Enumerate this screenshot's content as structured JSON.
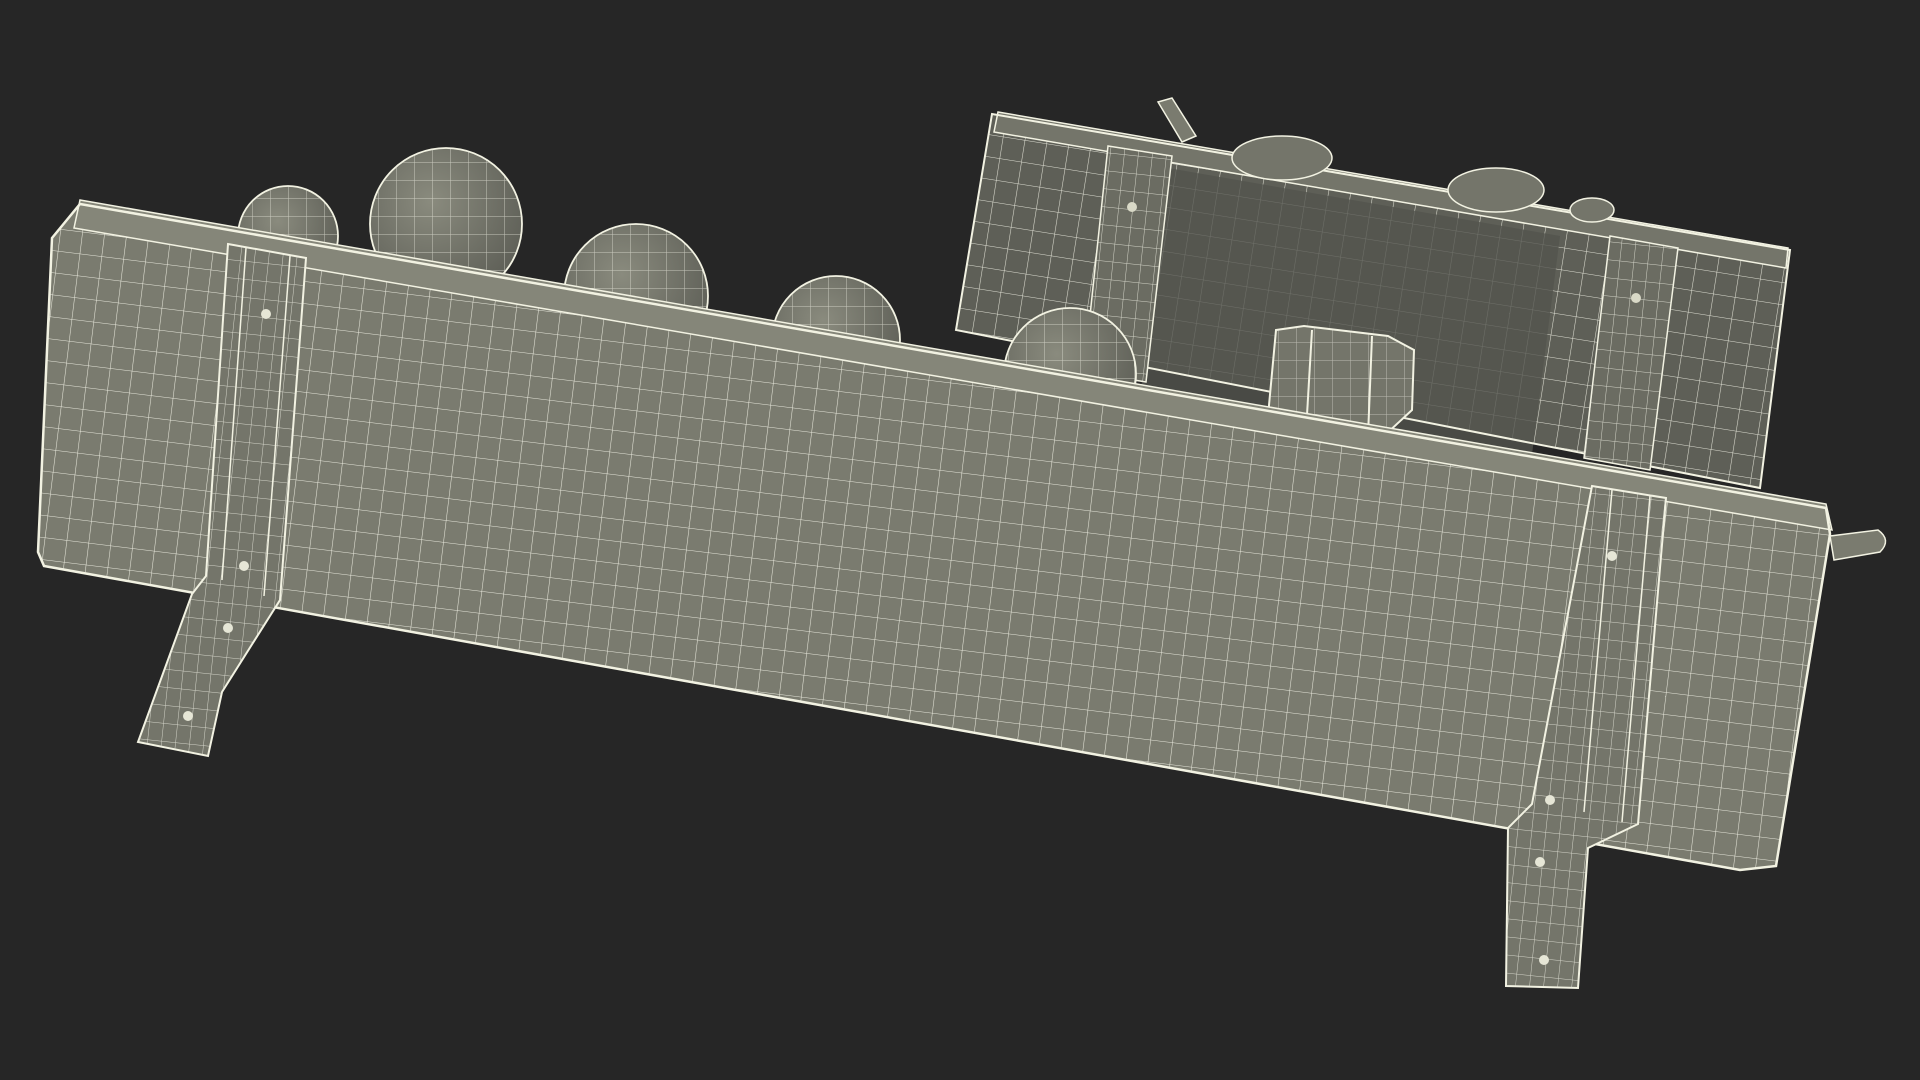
{
  "scene": {
    "subject": "wireframe-3d-model",
    "colors": {
      "background": "#262626",
      "surface": "#7a7b6f",
      "surface_dark": "#5f6058",
      "surface_shadow": "#53544d",
      "wire": "#f2f2e2",
      "wire_dim": "#d9d9c7"
    }
  }
}
